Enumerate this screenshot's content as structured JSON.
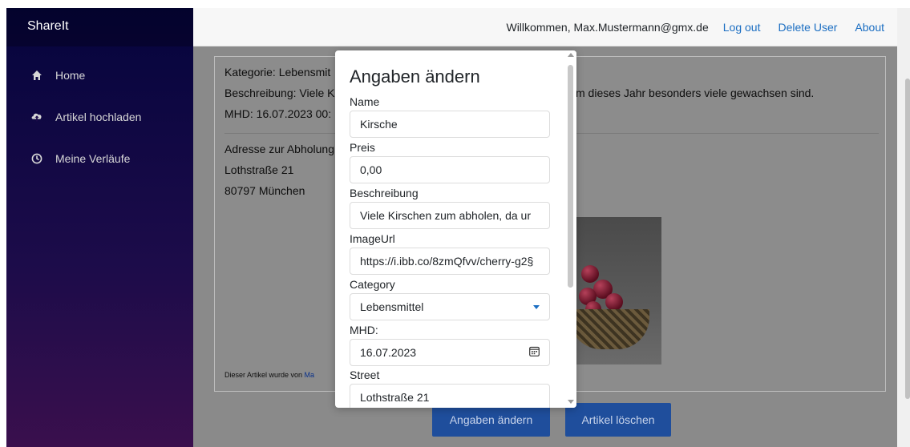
{
  "sidebar": {
    "brand": "ShareIt",
    "items": [
      {
        "label": "Home",
        "icon": "home-icon"
      },
      {
        "label": "Artikel hochladen",
        "icon": "upload-icon"
      },
      {
        "label": "Meine Verläufe",
        "icon": "clock-icon"
      }
    ]
  },
  "topbar": {
    "welcome": "Willkommen, Max.Mustermann@gmx.de",
    "logout": "Log out",
    "delete_user": "Delete User",
    "about": "About"
  },
  "article": {
    "category": "Kategorie: Lebensmit",
    "description": "Beschreibung: Viele K",
    "description_tail": "m dieses Jahr besonders viele gewachsen sind.",
    "mhd": "MHD: 16.07.2023 00:",
    "address_label": "Adresse zur Abholung",
    "street": "Lothstraße 21",
    "city": "80797 München",
    "author_prefix": "Dieser Artikel wurde von ",
    "author_link": "Ma"
  },
  "buttons": {
    "edit": "Angaben ändern",
    "delete": "Artikel löschen"
  },
  "modal": {
    "title": "Angaben ändern",
    "fields": {
      "name_label": "Name",
      "name_value": "Kirsche",
      "price_label": "Preis",
      "price_value": "0,00",
      "description_label": "Beschreibung",
      "description_value": "Viele Kirschen zum abholen, da ur",
      "imageurl_label": "ImageUrl",
      "imageurl_value": "https://i.ibb.co/8zmQfvv/cherry-g2§",
      "category_label": "Category",
      "category_value": "Lebensmittel",
      "mhd_label": "MHD:",
      "mhd_value": "16.07.2023",
      "street_label": "Street",
      "street_value": "Lothstraße 21"
    }
  },
  "colors": {
    "sidebar_top": "#05043d",
    "sidebar_bottom": "#3a0f4d",
    "link": "#1b6ec2",
    "button": "#1f4e9c"
  }
}
